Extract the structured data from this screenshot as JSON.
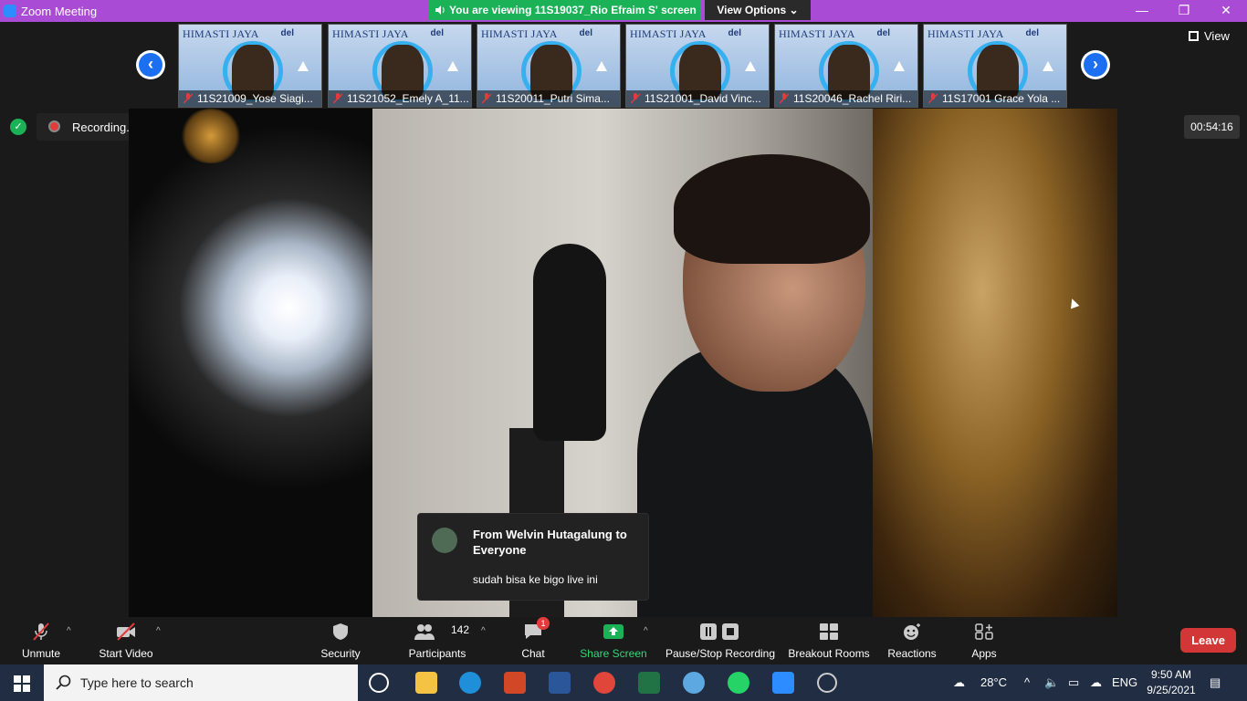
{
  "window": {
    "title": "Zoom Meeting",
    "viewing_banner": "You are viewing 11S19037_Rio Efraim S' screen",
    "view_options": "View Options"
  },
  "thumbnails": [
    {
      "header": "HIMASTI JAYA",
      "brand": "del",
      "name": "11S21009_Yose Siagi..."
    },
    {
      "header": "HIMASTI JAYA",
      "brand": "del",
      "name": "11S21052_Emely A_11..."
    },
    {
      "header": "HIMASTI JAYA",
      "brand": "del",
      "name": "11S20011_Putri Sima..."
    },
    {
      "header": "HIMASTI JAYA",
      "brand": "del",
      "name": "11S21001_David Vinc..."
    },
    {
      "header": "HIMASTI JAYA",
      "brand": "del",
      "name": "11S20046_Rachel Riri..."
    },
    {
      "header": "HIMASTI JAYA",
      "brand": "del",
      "name": "11S17001 Grace Yola ..."
    }
  ],
  "view_button": "View",
  "recording": {
    "label": "Recording..."
  },
  "timer": "00:54:16",
  "chat_popup": {
    "from": "From Welvin Hutagalung to Everyone",
    "message": "sudah bisa ke bigo live ini"
  },
  "toolbar": {
    "unmute": "Unmute",
    "start_video": "Start Video",
    "security": "Security",
    "participants": "Participants",
    "participants_count": "142",
    "chat": "Chat",
    "chat_badge": "1",
    "share_screen": "Share Screen",
    "pause_stop_recording": "Pause/Stop Recording",
    "breakout_rooms": "Breakout Rooms",
    "reactions": "Reactions",
    "apps": "Apps",
    "leave": "Leave"
  },
  "taskbar": {
    "search_placeholder": "Type here to search",
    "weather": "28°C",
    "language": "ENG",
    "time": "9:50 AM",
    "date": "9/25/2021"
  },
  "colors": {
    "title_bar": "#a94bd4",
    "banner_green": "#1bb157",
    "leave_red": "#d23636",
    "accent_blue": "#1d6ff2"
  }
}
